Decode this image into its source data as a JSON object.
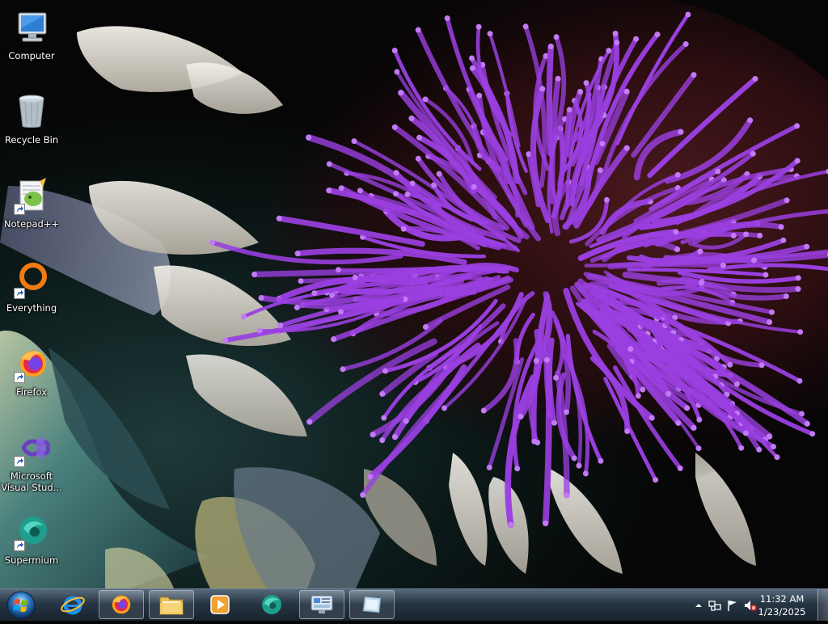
{
  "desktop": {
    "icons": [
      {
        "label": "Computer",
        "icon": "computer-icon",
        "shortcut": false
      },
      {
        "label": "Recycle Bin",
        "icon": "recycle-bin-icon",
        "shortcut": false
      },
      {
        "label": "Notepad++",
        "icon": "notepad-plus-plus-icon",
        "shortcut": true
      },
      {
        "label": "Everything",
        "icon": "everything-search-icon",
        "shortcut": true
      },
      {
        "label": "Firefox",
        "icon": "firefox-icon",
        "shortcut": true
      },
      {
        "label": "Microsoft Visual Stud...",
        "icon": "visual-studio-icon",
        "shortcut": true
      },
      {
        "label": "Supermium",
        "icon": "supermium-icon",
        "shortcut": true
      }
    ]
  },
  "taskbar": {
    "start_icon": "windows-orb-icon",
    "items": [
      {
        "name": "internet-explorer",
        "icon": "internet-explorer-icon",
        "open": false
      },
      {
        "name": "firefox",
        "icon": "firefox-icon",
        "open": true
      },
      {
        "name": "file-explorer",
        "icon": "folder-icon",
        "open": true
      },
      {
        "name": "media-player",
        "icon": "media-player-icon",
        "open": false
      },
      {
        "name": "supermium",
        "icon": "supermium-icon",
        "open": false
      },
      {
        "name": "control-panel",
        "icon": "control-panel-icon",
        "open": true
      },
      {
        "name": "app-window",
        "icon": "window-icon",
        "open": true
      }
    ],
    "tray": {
      "icons": [
        "show-hidden-icons-arrow",
        "network-icon",
        "action-center-flag-icon",
        "volume-muted-icon"
      ],
      "time": "11:32 AM",
      "date": "1/23/2025"
    }
  },
  "colors": {
    "stamen_purple": "#9a3fe0",
    "taskbar_dark": "#1c2836"
  }
}
